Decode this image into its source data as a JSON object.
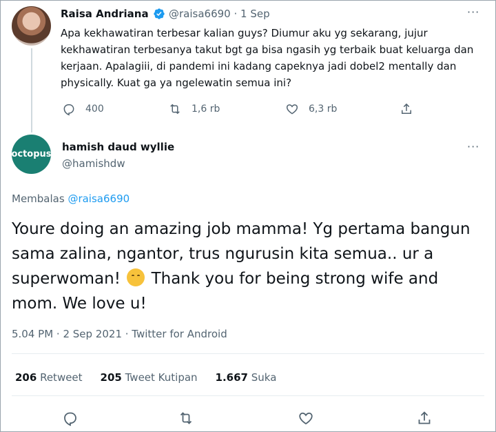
{
  "parent": {
    "name": "Raisa Andriana",
    "handle_date": "@raisa6690 · 1 Sep",
    "text": "Apa kekhawatiran terbesar kalian guys? Diumur aku yg sekarang, jujur kekhawatiran terbesanya takut bgt ga bisa ngasih yg terbaik buat keluarga dan kerjaan. Apalagiii, di pandemi ini kadang capeknya jadi dobel2 mentally dan physically. Kuat ga ya ngelewatin semua ini?",
    "reply_count": "400",
    "retweet_count": "1,6 rb",
    "like_count": "6,3 rb",
    "more": "···"
  },
  "reply": {
    "avatar_text": "octopus",
    "name": "hamish daud wyllie",
    "handle": "@hamishdw",
    "more": "···",
    "replying_prefix": "Membalas ",
    "replying_to": "@raisa6690",
    "text_part1": "Youre doing an amazing job mamma! Yg pertama bangun sama zalina, ngantor,  trus ngurusin kita semua.. ur a superwoman!",
    "text_part2": " Thank you for being strong wife and mom. We love u!",
    "meta": "5.04 PM · 2 Sep 2021 · Twitter for Android",
    "retweets_num": "206",
    "retweets_label": " Retweet",
    "quotes_num": "205",
    "quotes_label": " Tweet Kutipan",
    "likes_num": "1.667",
    "likes_label": " Suka"
  },
  "colors": {
    "accent": "#1d9bf0",
    "secondary_text": "#536471",
    "verified": "#1d9bf0"
  }
}
